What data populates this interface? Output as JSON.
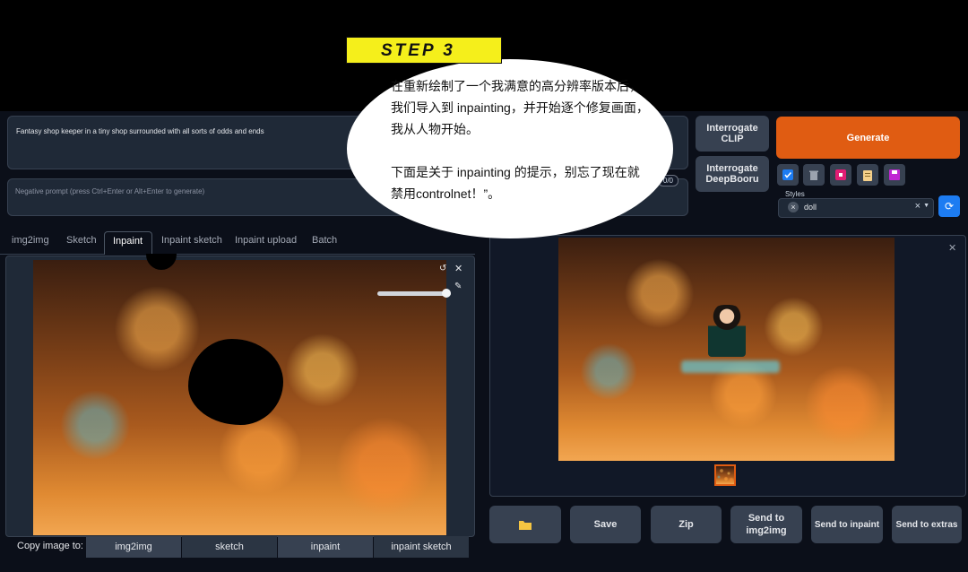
{
  "annotation": {
    "step_label": "STEP 3",
    "bubble_text_1": "在重新绘制了一个我满意的高分辨率版本后，我们导入到 inpainting，并开始逐个修复画面，我从人物开始。",
    "bubble_text_2": "下面是关于 inpainting 的提示，别忘了现在就禁用controlnet！”。"
  },
  "prompt": {
    "positive": "Fantasy shop keeper in a tiny shop surrounded with all sorts of odds and ends",
    "negative_placeholder": "Negative prompt (press Ctrl+Enter or Alt+Enter to generate)",
    "token_counter": "0/0"
  },
  "interrogate": {
    "clip": "Interrogate CLIP",
    "deepbooru": "Interrogate DeepBooru"
  },
  "generate_label": "Generate",
  "styles": {
    "label": "Styles",
    "selected": "doll"
  },
  "tabs": [
    "img2img",
    "Sketch",
    "Inpaint",
    "Inpaint sketch",
    "Inpaint upload",
    "Batch"
  ],
  "copy_image": {
    "label": "Copy image to:",
    "targets": [
      "img2img",
      "sketch",
      "inpaint",
      "inpaint sketch"
    ]
  },
  "output_buttons": {
    "save": "Save",
    "zip": "Zip",
    "send_img2img": "Send to img2img",
    "send_inpaint": "Send to inpaint",
    "send_extras": "Send to extras"
  },
  "colors": {
    "generate": "#e05c12",
    "background": "#0b0f19",
    "step_yellow": "#f5ef1b"
  },
  "icons": [
    "close-icon",
    "undo-icon",
    "brush-icon",
    "folder-icon",
    "trash-icon",
    "paste-icon",
    "clipboard-icon",
    "save-icon",
    "refresh-icon",
    "checkbox-icon"
  ]
}
